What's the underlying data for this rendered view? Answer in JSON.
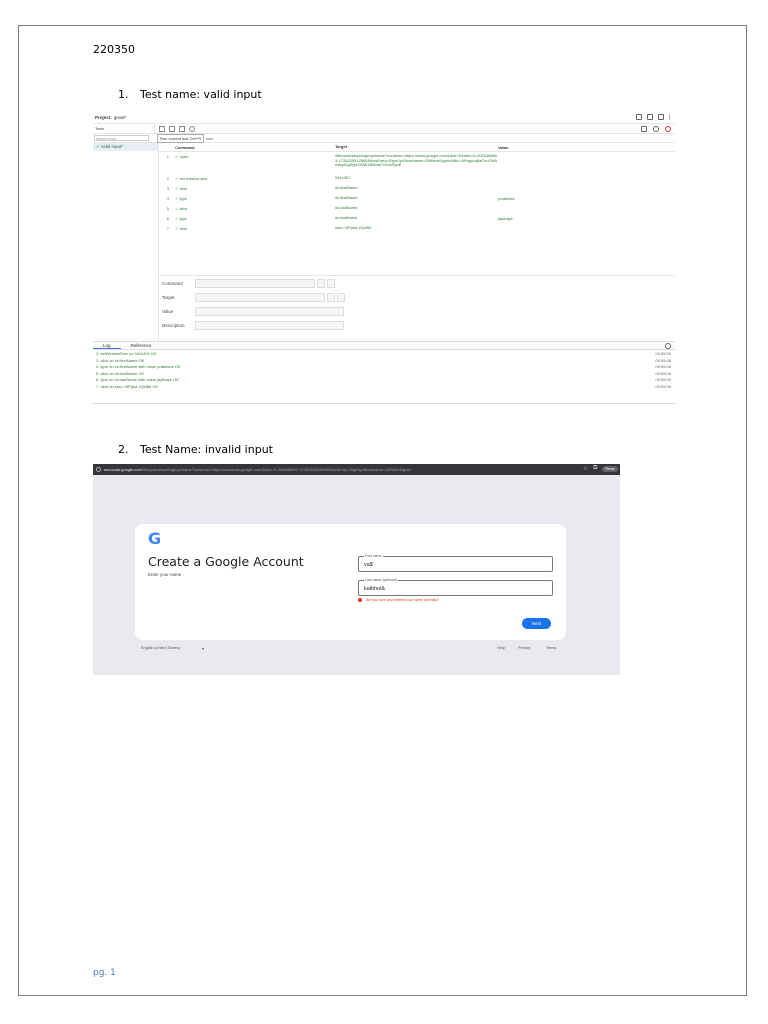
{
  "doc_id": "220350",
  "sections": [
    {
      "number": "1.",
      "title": "Test name: valid input"
    },
    {
      "number": "2.",
      "title": "Test Name: invalid input"
    }
  ],
  "footer": "pg. 1",
  "ide": {
    "project_label": "Project:",
    "project_name": "gmail*",
    "tests_dropdown": "Tests",
    "search_placeholder": "Search tests...",
    "run_tooltip": "Run current test  Ctrl+R",
    "url_value": "com",
    "test_item": "✓ valid input*",
    "columns": {
      "command": "Command",
      "target": "Target",
      "value": "Value"
    },
    "rows": [
      {
        "num": "1",
        "command": "✓ open",
        "target": "/lifecycle/steps/signup/name?continue=https://www.google.com&dsh=S&ddlc=0-2026488853-1726235512566&flowEntry=SignUp&flowName=GlifWebSignIn&ifkv=ARdgcrq8aGxu7WAuvtgdQq5gwODW1BdbdyTmCkRgnE",
        "value": ""
      },
      {
        "num": "2",
        "command": "✓ set window size",
        "target": "541x301",
        "value": ""
      },
      {
        "num": "3",
        "command": "✓ click",
        "target": "id=firstName",
        "value": ""
      },
      {
        "num": "4",
        "command": "✓ type",
        "target": "id=firstName",
        "value": "prabksha"
      },
      {
        "num": "5",
        "command": "✓ click",
        "target": "id=lastName",
        "value": ""
      },
      {
        "num": "6",
        "command": "✓ type",
        "target": "id=lastName",
        "value": "jaythaye"
      },
      {
        "num": "7",
        "command": "✓ click",
        "target": "css=.VfPpkd-vQzf8d",
        "value": ""
      }
    ],
    "editor_labels": {
      "command": "Command",
      "target": "Target",
      "value": "Value",
      "description": "Description"
    },
    "log_tabs": {
      "log": "Log",
      "reference": "Reference"
    },
    "log_lines": [
      {
        "text": "2.  setWindowSize on 541x301 OK",
        "time": "09:55:06"
      },
      {
        "text": "3.  click on id=firstName OK",
        "time": "09:55:06"
      },
      {
        "text": "4.  type on id=firstName with value prabksha OK",
        "time": "09:55:06"
      },
      {
        "text": "5.  click on id=lastName OK",
        "time": "09:55:06"
      },
      {
        "text": "6.  type on id=lastName with value jaythaye OK",
        "time": "09:55:06"
      },
      {
        "text": "7.  click on css=.VfPpkd-vQzf8d OK",
        "time": "09:55:06"
      }
    ]
  },
  "google": {
    "url_domain": "accounts.google.com",
    "url_path": "/lifecycle/steps/signup/name?continue=https://accounts.google.com/&dsh=S-466545891:1726235583565&flowEntry=SignUp&flowName=GlifWebSignIn",
    "logo": "G",
    "title": "Create a Google Account",
    "subtitle": "Enter your name",
    "first_name_label": "First name",
    "first_name_value": "va$",
    "last_name_label": "Last name (optional)",
    "last_name_value": "kalbhol&",
    "error_text": "Are you sure you entered your name correctly?",
    "next_button": "Next",
    "footer_lang": "English (United States)",
    "footer_caret": "▾",
    "footer_help": "Help",
    "footer_privacy": "Privacy",
    "footer_terms": "Terms",
    "bb_button": "Rerun"
  }
}
